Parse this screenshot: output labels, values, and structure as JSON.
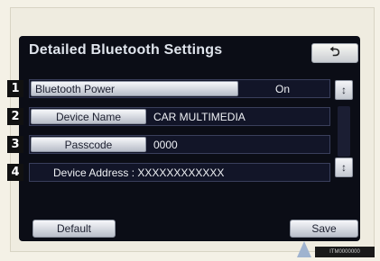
{
  "title": "Detailed Bluetooth Settings",
  "back_icon": "return-arrow-icon",
  "rows": [
    {
      "number": "1",
      "label": "Bluetooth Power",
      "value": "On"
    },
    {
      "number": "2",
      "label": "Device Name",
      "value": "CAR MULTIMEDIA"
    },
    {
      "number": "3",
      "label": "Passcode",
      "value": "0000"
    },
    {
      "number": "4",
      "label": "Device Address : XXXXXXXXXXXX",
      "value": ""
    }
  ],
  "buttons": {
    "default_label": "Default",
    "save_label": "Save"
  },
  "ref_code": "ITM0000000"
}
